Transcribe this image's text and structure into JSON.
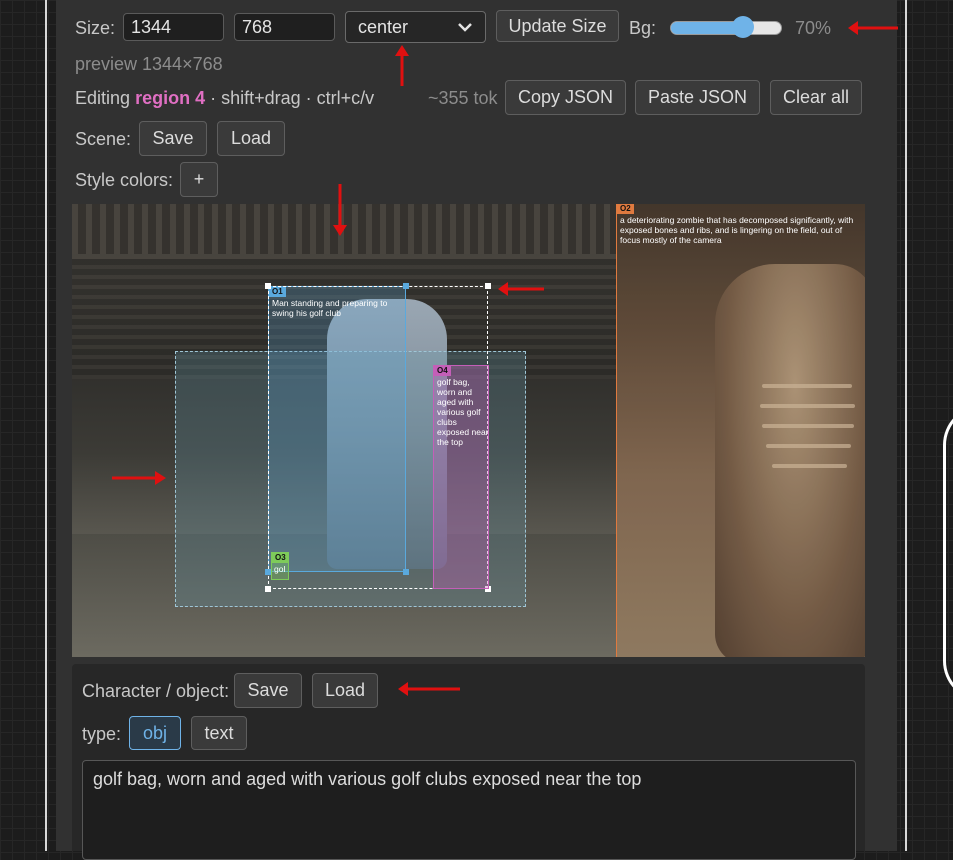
{
  "toolbar": {
    "size_label": "Size:",
    "width_value": "1344",
    "height_value": "768",
    "align_selected": "center",
    "update_size_label": "Update Size",
    "bg_label": "Bg:",
    "bg_value_text": "70%",
    "bg_level_percent": 70
  },
  "preview_text": "preview 1344×768",
  "editing": {
    "prefix": "Editing",
    "region_name": "region 4",
    "hint": "· shift+drag · ctrl+c/v",
    "token_count": "~355 tok",
    "copy_json_label": "Copy JSON",
    "paste_json_label": "Paste JSON",
    "clear_all_label": "Clear all"
  },
  "scene": {
    "label": "Scene:",
    "save_label": "Save",
    "load_label": "Load"
  },
  "style_colors": {
    "label": "Style colors:",
    "add_label": "+"
  },
  "regions": [
    {
      "tag": "O1",
      "text": "Man standing and preparing to swing his golf club",
      "color": "#5aa9dd"
    },
    {
      "tag": "O2",
      "text": "a deteriorating zombie that has decomposed significantly, with exposed bones and ribs, and is lingering on the field, out of focus mostly of the camera",
      "color": "#e07a3f"
    },
    {
      "tag": "O3",
      "text": "gol",
      "color": "#7ecb5a"
    },
    {
      "tag": "O4",
      "text": "golf bag, worn and aged with various golf clubs exposed near the top",
      "color": "#c45fb8"
    }
  ],
  "character": {
    "label": "Character / object:",
    "save_label": "Save",
    "load_label": "Load",
    "type_label": "type:",
    "type_obj_label": "obj",
    "type_text_label": "text",
    "description": "golf bag, worn and aged with various golf clubs exposed near the top"
  },
  "colors": {
    "accent_blue": "#6fb3e8",
    "region_highlight_pink": "#e06fc3",
    "annotation_red": "#e01010"
  }
}
